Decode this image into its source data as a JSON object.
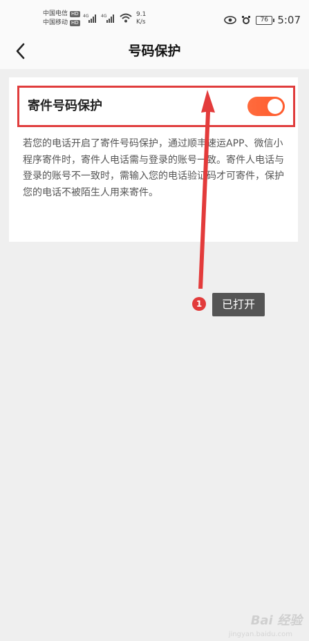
{
  "status_bar": {
    "carrier1": "中国电信",
    "carrier2": "中国移动",
    "hd": "HD",
    "net": "4G",
    "speed_value": "9.1",
    "speed_unit": "K/s",
    "battery": "76",
    "time": "5:07"
  },
  "header": {
    "title": "号码保护"
  },
  "setting": {
    "label": "寄件号码保护",
    "enabled": true,
    "description": "若您的电话开启了寄件号码保护，通过顺丰速运APP、微信小程序寄件时，寄件人电话需与登录的账号一致。寄件人电话与登录的账号不一致时，需输入您的电话验证码才可寄件，保护您的电话不被陌生人用来寄件。"
  },
  "annotation": {
    "step": "1",
    "text": "已打开",
    "color": "#e23b3b"
  },
  "watermark": {
    "text": "Bai 经验",
    "sub": "jingyan.baidu.com"
  },
  "colors": {
    "toggle_on": "#ff5a2c",
    "highlight": "#e03c3c"
  }
}
